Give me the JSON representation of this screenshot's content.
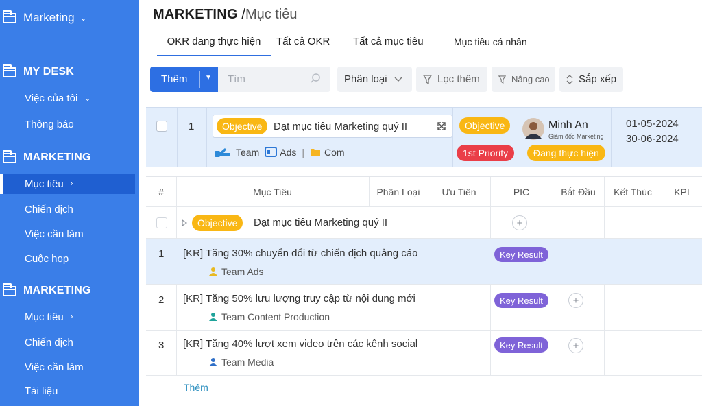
{
  "sidebar": {
    "workspace": "Marketing",
    "sections": [
      {
        "title": "MY DESK",
        "items": [
          "Việc của tôi",
          "Thông báo"
        ]
      },
      {
        "title": "MARKETING",
        "items": [
          "Mục tiêu",
          "Chiến dịch",
          "Việc cần làm",
          "Cuộc họp"
        ]
      },
      {
        "title": "MARKETING",
        "items": [
          "Mục tiêu",
          "Chiến dịch",
          "Việc cần làm",
          "Tài liệu"
        ]
      }
    ]
  },
  "header": {
    "title_bold": "MARKETING",
    "title_sep": " /",
    "title_light": "Mục tiêu"
  },
  "tabs": [
    "OKR đang thực hiện",
    "Tất cả OKR",
    "Tất cả mục tiêu",
    "Mục tiêu cá nhân"
  ],
  "toolbar": {
    "add_label": "Thêm",
    "search_placeholder": "Tìm",
    "classify_label": "Phân loại",
    "filter_label": "Lọc thêm",
    "advanced_label": "Nâng cao",
    "sort_label": "Sắp xếp"
  },
  "selected": {
    "index": "1",
    "badge": "Objective",
    "title": "Đạt mục tiêu Marketing quý II",
    "tags": [
      "Team",
      "Ads",
      "|",
      "Com"
    ],
    "type_badge": "Objective",
    "priority": "1st Priority",
    "status": "Đang thực hiện",
    "owner_name": "Minh An",
    "owner_role": "Giám đốc Marketing",
    "start_date": "01-05-2024",
    "end_date": "30-06-2024"
  },
  "table": {
    "columns": [
      "#",
      "Mục Tiêu",
      "Phân Loại",
      "Ưu Tiên",
      "PIC",
      "Bắt Đầu",
      "Kết Thúc",
      "KPI"
    ],
    "objective_row": {
      "badge": "Objective",
      "title": "Đạt mục tiêu Marketing quý II"
    },
    "rows": [
      {
        "index": "1",
        "title": "[KR]  Tăng 30% chuyển đổi từ chiến dịch quảng cáo",
        "team": "Team Ads",
        "badge": "Key Result"
      },
      {
        "index": "2",
        "title": "[KR]  Tăng 50% lưu lượng truy cập từ nội dung mới",
        "team": "Team Content Production",
        "badge": "Key Result"
      },
      {
        "index": "3",
        "title": "[KR]  Tăng 40% lượt xem video trên các kênh social",
        "team": "Team Media",
        "badge": "Key Result"
      }
    ],
    "add_label": "Thêm"
  },
  "colors": {
    "sidebar": "#3a7ee8",
    "sidebar_active": "#1f5fd1",
    "primary": "#2d6fe3",
    "objective": "#f9b714",
    "key_result": "#7f63d8",
    "priority": "#ea3e48",
    "selected_bg": "#e3eefc"
  }
}
